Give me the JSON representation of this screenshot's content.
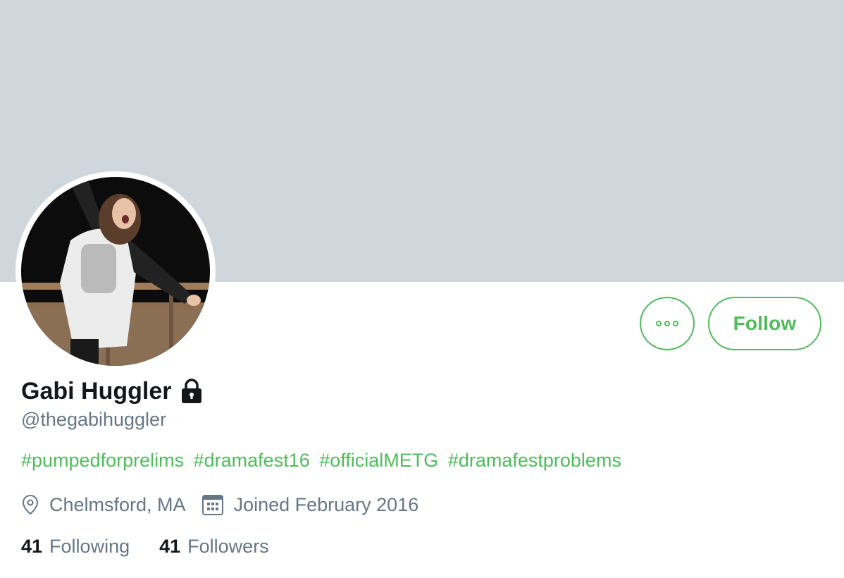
{
  "profile": {
    "display_name": "Gabi Huggler",
    "handle": "@thegabihuggler",
    "protected_icon": "lock-icon",
    "bio_hashtags": [
      "#pumpedforprelims",
      "#dramafest16",
      "#officialMETG",
      "#dramafestproblems"
    ],
    "location": "Chelmsford, MA",
    "location_icon": "map-pin-icon",
    "joined": "Joined February 2016",
    "joined_icon": "calendar-icon",
    "following_count": "41",
    "following_label": "Following",
    "followers_count": "41",
    "followers_label": "Followers"
  },
  "actions": {
    "more_icon": "more-options-icon",
    "follow_label": "Follow"
  },
  "colors": {
    "accent": "#4fbb5b",
    "banner": "#cfd6dc",
    "primary_text": "#14171a",
    "secondary_text": "#657786"
  }
}
